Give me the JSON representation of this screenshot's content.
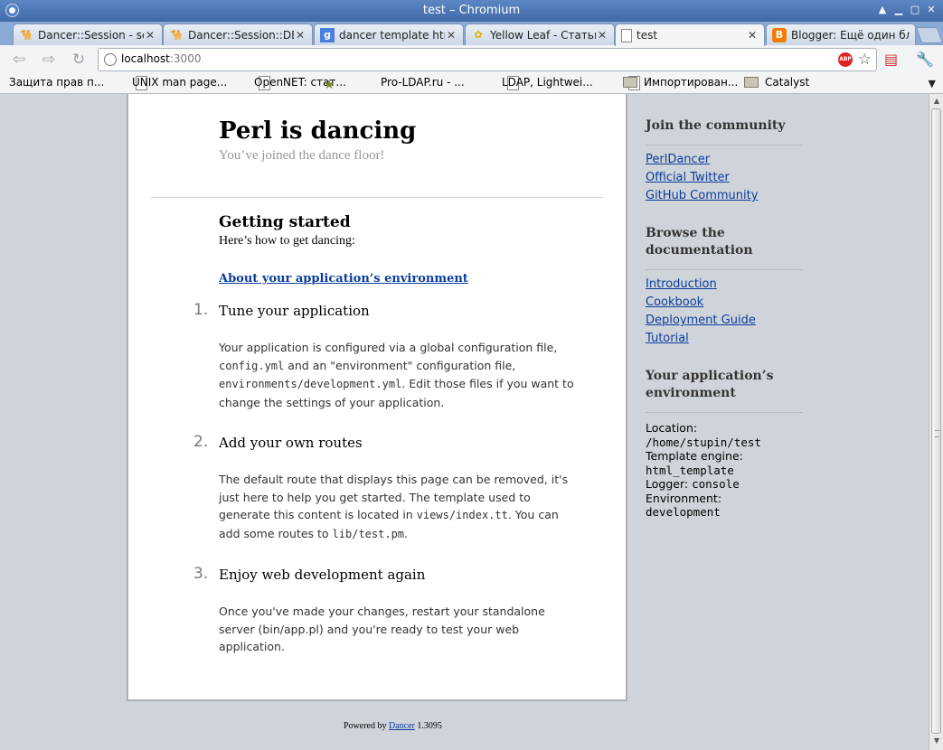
{
  "window": {
    "title": "test – Chromium",
    "controls": [
      "up-arrow-icon",
      "minimize-icon",
      "maximize-icon",
      "close-icon"
    ]
  },
  "tabs": [
    {
      "label": "Dancer::Session - se",
      "icon": "camel-icon",
      "active": false
    },
    {
      "label": "Dancer::Session::DB",
      "icon": "camel-icon",
      "active": false
    },
    {
      "label": "dancer template html",
      "icon": "google-icon",
      "active": false
    },
    {
      "label": "Yellow Leaf - Статьи",
      "icon": "leaf-icon",
      "active": false
    },
    {
      "label": "test",
      "icon": "page-icon",
      "active": true
    },
    {
      "label": "Blogger: Ещё один бл",
      "icon": "blogger-icon",
      "active": false
    }
  ],
  "toolbar": {
    "url_host": "localhost",
    "url_port": ":3000",
    "abp_label": "ABP"
  },
  "bookmarks": [
    {
      "label": "Защита прав п...",
      "icon": "page"
    },
    {
      "label": "UNIX man page...",
      "icon": "page"
    },
    {
      "label": "OpenNET: стат...",
      "icon": "star"
    },
    {
      "label": "Pro-LDAP.ru - ...",
      "icon": "page"
    },
    {
      "label": "LDAP, Lightwei...",
      "icon": "page"
    },
    {
      "label": "Импортирован...",
      "icon": "folder"
    },
    {
      "label": "Catalyst",
      "icon": "folder"
    }
  ],
  "page": {
    "title": "Perl is dancing",
    "subtitle": "You’ve joined the dance floor!",
    "getting_started": "Getting started",
    "getting_started_sub": "Here’s how to get dancing:",
    "env_link": "About your application’s environment",
    "steps": [
      {
        "num": "1.",
        "title": "Tune your application",
        "p1": "Your application is configured via a global configuration file,",
        "code1": "config.yml",
        "p2": " and an \"environment\" configuration file,",
        "code2": "environments/development.yml",
        "p3": ". Edit those files if you want to change the settings of your application."
      },
      {
        "num": "2.",
        "title": "Add your own routes",
        "p1": "The default route that displays this page can be removed, it's just here to help you get started. The template used to generate this content is located in ",
        "code1": "views/index.tt",
        "p2": ". You can add some routes to ",
        "code2": "lib/test.pm",
        "p3": "."
      },
      {
        "num": "3.",
        "title": "Enjoy web development again",
        "p1": "Once you've made your changes, restart your standalone server (bin/app.pl) and you're ready to test your web application."
      }
    ],
    "footer_prefix": "Powered by ",
    "footer_link": "Dancer",
    "footer_version": " 1.3095"
  },
  "sidebar": {
    "community_heading": "Join the community",
    "community_links": [
      "PerlDancer",
      "Official Twitter",
      "GitHub Community"
    ],
    "docs_heading_line1": "Browse the",
    "docs_heading_line2": "documentation",
    "docs_links": [
      "Introduction",
      "Cookbook",
      "Deployment Guide",
      "Tutorial"
    ],
    "env_heading_line1": "Your application’s",
    "env_heading_line2": "environment",
    "env": {
      "location_label": "Location:",
      "location_value": "/home/stupin/test",
      "template_label": "Template engine:",
      "template_value": "html_template",
      "logger_label": "Logger:",
      "logger_value": "console",
      "environment_label": "Environment:",
      "environment_value": "development"
    }
  }
}
